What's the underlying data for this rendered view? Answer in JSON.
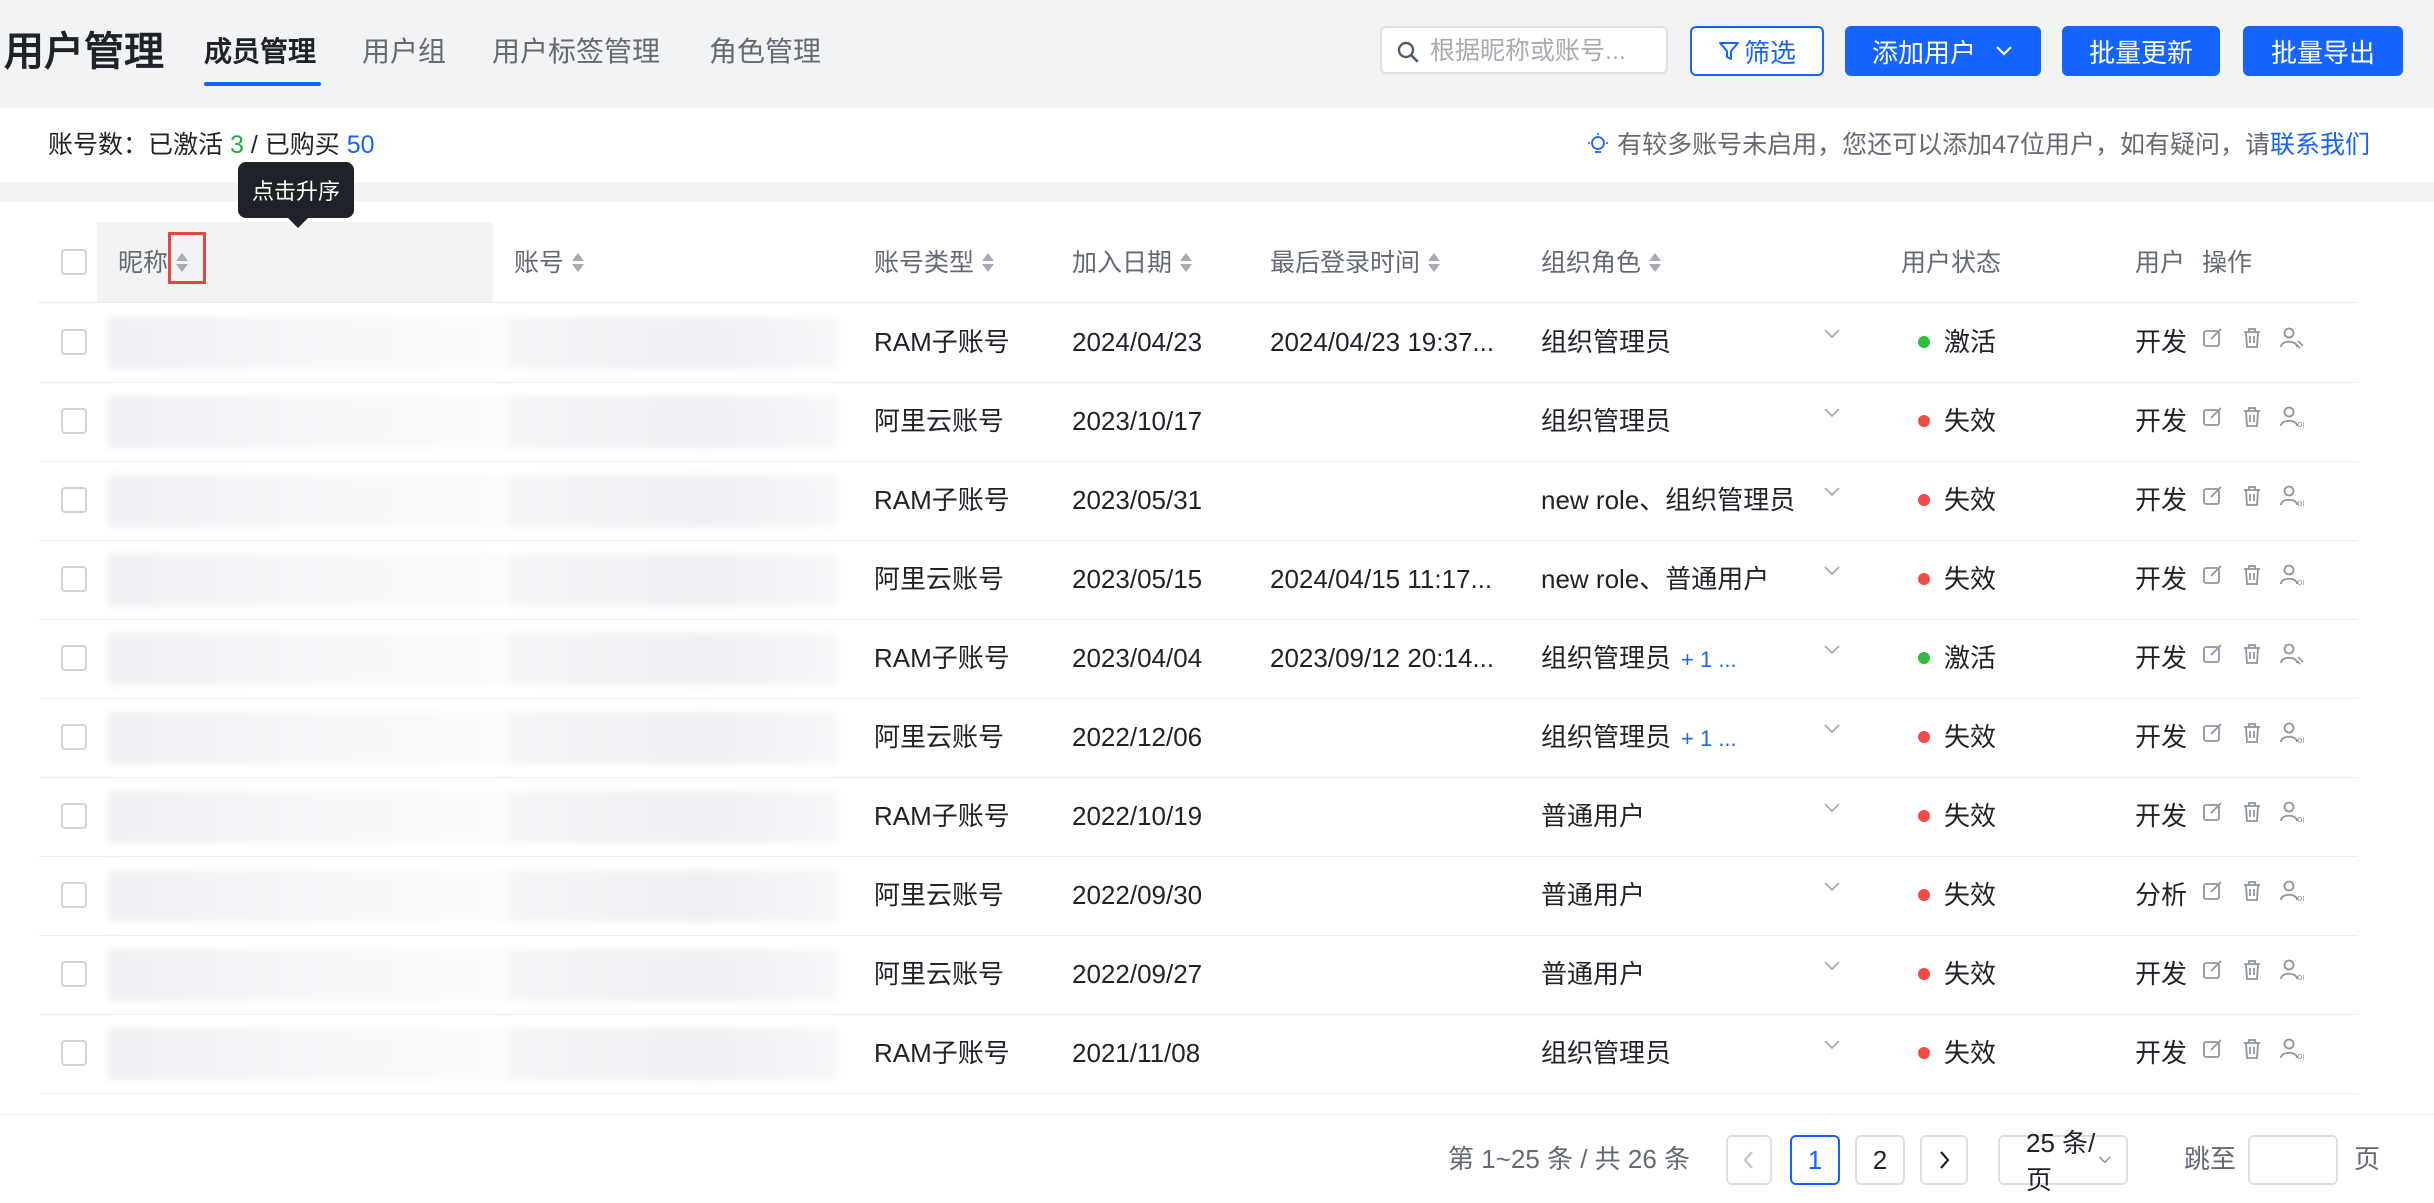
{
  "header": {
    "title": "用户管理",
    "tabs": [
      "成员管理",
      "用户组",
      "用户标签管理",
      "角色管理"
    ],
    "search_placeholder": "根据昵称或账号...",
    "filter_label": "筛选",
    "add_user_label": "添加用户",
    "batch_update_label": "批量更新",
    "batch_export_label": "批量导出"
  },
  "info": {
    "prefix": "账号数：已激活",
    "activated": "3",
    "separator": "/ 已购买",
    "purchased": "50",
    "notice": "有较多账号未启用，您还可以添加47位用户，如有疑问，请",
    "contact_link": "联系我们"
  },
  "tooltip": "点击升序",
  "columns": {
    "nickname": "昵称",
    "account": "账号",
    "account_type": "账号类型",
    "join_date": "加入日期",
    "last_login": "最后登录时间",
    "org_role": "组织角色",
    "user_status": "用户状态",
    "user_group": "用户",
    "actions": "操作"
  },
  "rows": [
    {
      "account_type": "RAM子账号",
      "join_date": "2024/04/23",
      "last_login": "2024/04/23 19:37...",
      "role": "组织管理员",
      "more": "",
      "status": "激活",
      "status_key": "active",
      "group": "开发"
    },
    {
      "account_type": "阿里云账号",
      "join_date": "2023/10/17",
      "last_login": "",
      "role": "组织管理员",
      "more": "",
      "status": "失效",
      "status_key": "inactive",
      "group": "开发"
    },
    {
      "account_type": "RAM子账号",
      "join_date": "2023/05/31",
      "last_login": "",
      "role": "new role、组织管理员",
      "more": "",
      "status": "失效",
      "status_key": "inactive",
      "group": "开发"
    },
    {
      "account_type": "阿里云账号",
      "join_date": "2023/05/15",
      "last_login": "2024/04/15 11:17...",
      "role": "new role、普通用户",
      "more": "",
      "status": "失效",
      "status_key": "inactive",
      "group": "开发"
    },
    {
      "account_type": "RAM子账号",
      "join_date": "2023/04/04",
      "last_login": "2023/09/12 20:14...",
      "role": "组织管理员",
      "more": "+ 1 ...",
      "status": "激活",
      "status_key": "active",
      "group": "开发"
    },
    {
      "account_type": "阿里云账号",
      "join_date": "2022/12/06",
      "last_login": "",
      "role": "组织管理员",
      "more": "+ 1 ...",
      "status": "失效",
      "status_key": "inactive",
      "group": "开发"
    },
    {
      "account_type": "RAM子账号",
      "join_date": "2022/10/19",
      "last_login": "",
      "role": "普通用户",
      "more": "",
      "status": "失效",
      "status_key": "inactive",
      "group": "开发"
    },
    {
      "account_type": "阿里云账号",
      "join_date": "2022/09/30",
      "last_login": "",
      "role": "普通用户",
      "more": "",
      "status": "失效",
      "status_key": "inactive",
      "group": "分析"
    },
    {
      "account_type": "阿里云账号",
      "join_date": "2022/09/27",
      "last_login": "",
      "role": "普通用户",
      "more": "",
      "status": "失效",
      "status_key": "inactive",
      "group": "开发"
    },
    {
      "account_type": "RAM子账号",
      "join_date": "2021/11/08",
      "last_login": "",
      "role": "组织管理员",
      "more": "",
      "status": "失效",
      "status_key": "inactive",
      "group": "开发"
    }
  ],
  "pagination": {
    "total_text": "第 1~25 条 / 共 26 条",
    "pages": [
      "1",
      "2"
    ],
    "current_page": "1",
    "page_size": "25 条/页",
    "goto_label": "跳至",
    "page_unit": "页"
  },
  "colors": {
    "primary": "#1664ff",
    "active": "#2dbd3a",
    "inactive": "#f54a45",
    "highlight": "#e8453c"
  }
}
